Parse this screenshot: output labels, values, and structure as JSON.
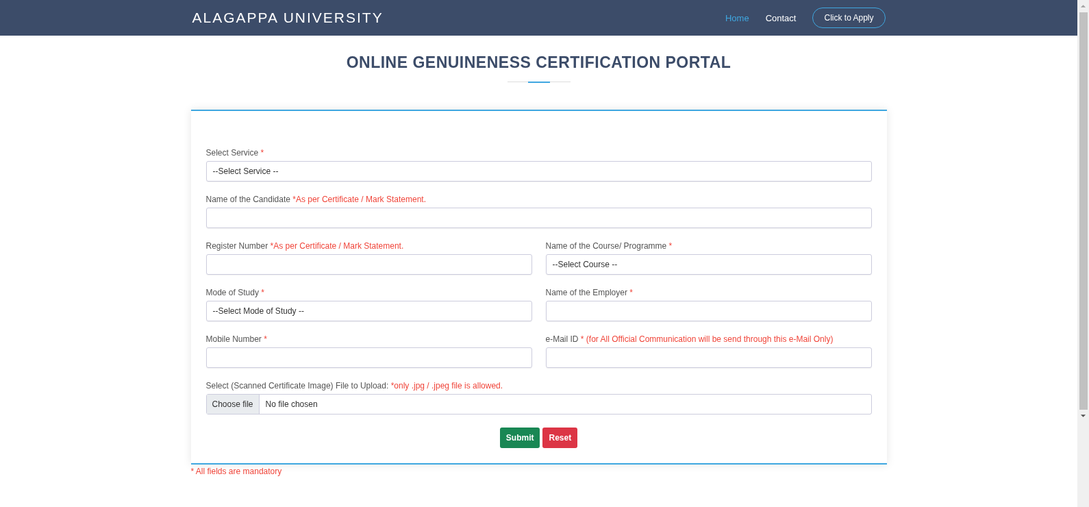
{
  "navbar": {
    "brand": "ALAGAPPA UNIVERSITY",
    "links": [
      {
        "label": "Home",
        "selected": true
      },
      {
        "label": "Contact",
        "selected": false
      }
    ],
    "apply_button": "Click to Apply"
  },
  "page_title": "ONLINE GENUINENESS CERTIFICATION PORTAL",
  "form": {
    "rows": [
      [
        {
          "kind": "select",
          "label": "Select Service",
          "note": "*",
          "value": "--Select Service --"
        }
      ],
      [
        {
          "kind": "text",
          "label": "Name of the Candidate",
          "note": "*As per Certificate / Mark Statement."
        }
      ],
      [
        {
          "kind": "text",
          "label": "Register Number",
          "note": "*As per Certificate / Mark Statement."
        },
        {
          "kind": "select",
          "label": "Name of the Course/ Programme",
          "note": "*",
          "value": "--Select Course --"
        }
      ],
      [
        {
          "kind": "select",
          "label": "Mode of Study",
          "note": "*",
          "value": "--Select Mode of Study --"
        },
        {
          "kind": "text",
          "label": "Name of the Employer",
          "note": "*"
        }
      ],
      [
        {
          "kind": "text",
          "label": "Mobile Number",
          "note": "*"
        },
        {
          "kind": "text",
          "label": "e-Mail ID",
          "note": "* (for All Official Communication will be send through this e-Mail Only)"
        }
      ],
      [
        {
          "kind": "file",
          "label": "Select (Scanned Certificate Image) File to Upload:",
          "note": "*only .jpg / .jpeg file is allowed.",
          "button": "Choose file",
          "value": "No file chosen"
        }
      ]
    ],
    "buttons": [
      {
        "label": "Submit",
        "kind": "submit"
      },
      {
        "label": "Reset",
        "kind": "reset"
      }
    ]
  },
  "footer_note": "* All fields are mandatory"
}
